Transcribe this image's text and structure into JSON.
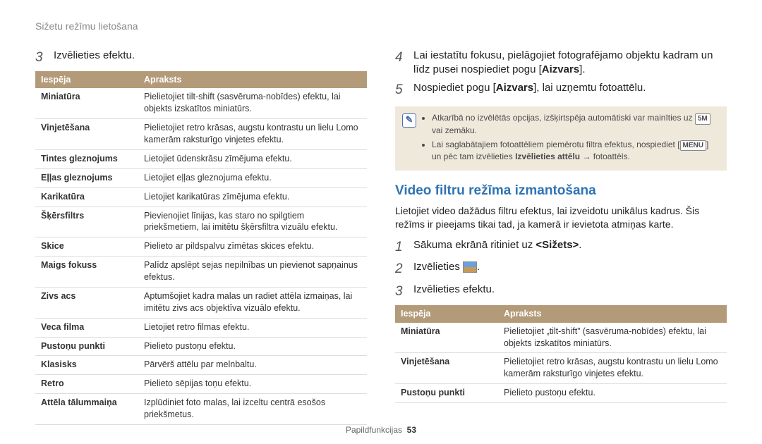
{
  "running_head": "Sižetu režīmu lietošana",
  "left": {
    "step3_num": "3",
    "step3_text": "Izvēlieties efektu.",
    "th_option": "Iespēja",
    "th_desc": "Apraksts",
    "rows": [
      {
        "opt": "Miniatūra",
        "desc": "Pielietojiet tilt-shift (sasvēruma-nobīdes) efektu, lai objekts izskatītos miniatūrs."
      },
      {
        "opt": "Vinjetēšana",
        "desc": "Pielietojiet retro krāsas, augstu kontrastu un lielu Lomo kamerām raksturīgo vinjetes efektu."
      },
      {
        "opt": "Tintes gleznojums",
        "desc": "Lietojiet ūdenskrāsu zīmējuma efektu."
      },
      {
        "opt": "Eļļas gleznojums",
        "desc": "Lietojiet eļļas gleznojuma efektu."
      },
      {
        "opt": "Karikatūra",
        "desc": "Lietojiet karikatūras zīmējuma efektu."
      },
      {
        "opt": "Šķērsfiltrs",
        "desc": "Pievienojiet līnijas, kas staro no spilgtiem priekšmetiem, lai imitētu šķērsfiltra vizuālu efektu."
      },
      {
        "opt": "Skice",
        "desc": "Pielieto ar pildspalvu zīmētas skices efektu."
      },
      {
        "opt": "Maigs fokuss",
        "desc": "Palīdz apslēpt sejas nepilnības un pievienot sapņainus efektus."
      },
      {
        "opt": "Zivs acs",
        "desc": "Aptumšojiet kadra malas un radiet attēla izmaiņas, lai imitētu zivs acs objektīva vizuālo efektu."
      },
      {
        "opt": "Veca filma",
        "desc": "Lietojiet retro filmas efektu."
      },
      {
        "opt": "Pustoņu punkti",
        "desc": "Pielieto pustoņu efektu."
      },
      {
        "opt": "Klasisks",
        "desc": "Pārvērš attēlu par melnbaltu."
      },
      {
        "opt": "Retro",
        "desc": "Pielieto sēpijas toņu efektu."
      },
      {
        "opt": "Attēla tālummaiņa",
        "desc": "Izplūdiniet foto malas, lai izceltu centrā esošos priekšmetus."
      }
    ]
  },
  "right": {
    "step4_num": "4",
    "step4_text_a": "Lai iestatītu fokusu, pielāgojiet fotografējamo objektu kadram un līdz pusei nospiediet pogu [",
    "step4_bold": "Aizvars",
    "step4_text_b": "].",
    "step5_num": "5",
    "step5_text_a": "Nospiediet pogu [",
    "step5_bold": "Aizvars",
    "step5_text_b": "], lai uzņemtu fotoattēlu.",
    "note_items": [
      {
        "pre": "Atkarībā no izvēlētās opcijas, izšķirtspēja automātiski var mainīties uz ",
        "glyph": "5M",
        "post": " vai zemāku."
      },
      {
        "pre": "Lai saglabātajiem fotoattēliem piemērotu filtra efektus, nospiediet [",
        "glyph": "MENU",
        "post": "] un pēc tam izvēlieties ",
        "bold": "Izvēlieties attēlu",
        "tail": " → fotoattēls."
      }
    ],
    "h2": "Video filtru režīma izmantošana",
    "intro": "Lietojiet video dažādus filtru efektus, lai izveidotu unikālus kadrus. Šis režīms ir pieejams tikai tad, ja kamerā ir ievietota atmiņas karte.",
    "steps": [
      {
        "n": "1",
        "pre": "Sākuma ekrānā ritiniet uz ",
        "bold": "<Sižets>",
        "post": "."
      },
      {
        "n": "2",
        "pre": "Izvēlieties ",
        "icon": true,
        "post": "."
      },
      {
        "n": "3",
        "pre": "Izvēlieties efektu.",
        "bold": "",
        "post": ""
      }
    ],
    "th_option": "Iespēja",
    "th_desc": "Apraksts",
    "rows2": [
      {
        "opt": "Miniatūra",
        "desc": "Pielietojiet „tilt-shift” (sasvēruma-nobīdes) efektu, lai objekts izskatītos miniatūrs."
      },
      {
        "opt": "Vinjetēšana",
        "desc": "Pielietojiet retro krāsas, augstu kontrastu un lielu Lomo kamerām raksturīgo vinjetes efektu."
      },
      {
        "opt": "Pustoņu punkti",
        "desc": "Pielieto pustoņu efektu."
      }
    ]
  },
  "footer_label": "Papildfunkcijas",
  "footer_page": "53"
}
